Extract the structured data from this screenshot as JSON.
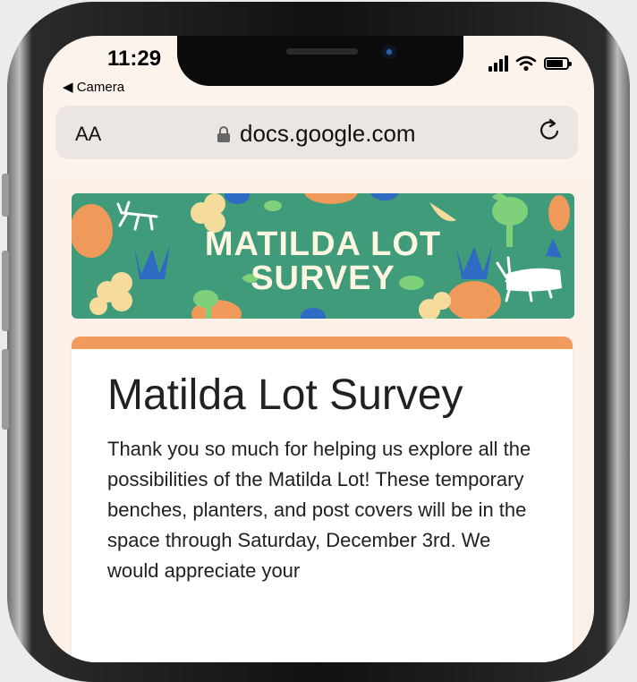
{
  "status_bar": {
    "time": "11:29",
    "back_label": "◀ Camera"
  },
  "browser": {
    "text_size_label": "AA",
    "url": "docs.google.com"
  },
  "banner": {
    "line1": "MATILDA LOT",
    "line2": "SURVEY"
  },
  "form": {
    "title": "Matilda Lot Survey",
    "description": "Thank you so much for helping us explore all the possibilities of the Matilda Lot! These temporary benches, planters, and post covers will be in the space through Saturday, December 3rd. We would appreciate your"
  },
  "colors": {
    "banner_green": "#3f9b79",
    "accent_orange": "#f29b5e",
    "page_bg": "#fcf1e8"
  },
  "icons": [
    "lock-icon",
    "reload-icon",
    "signal-icon",
    "wifi-icon",
    "battery-icon"
  ]
}
